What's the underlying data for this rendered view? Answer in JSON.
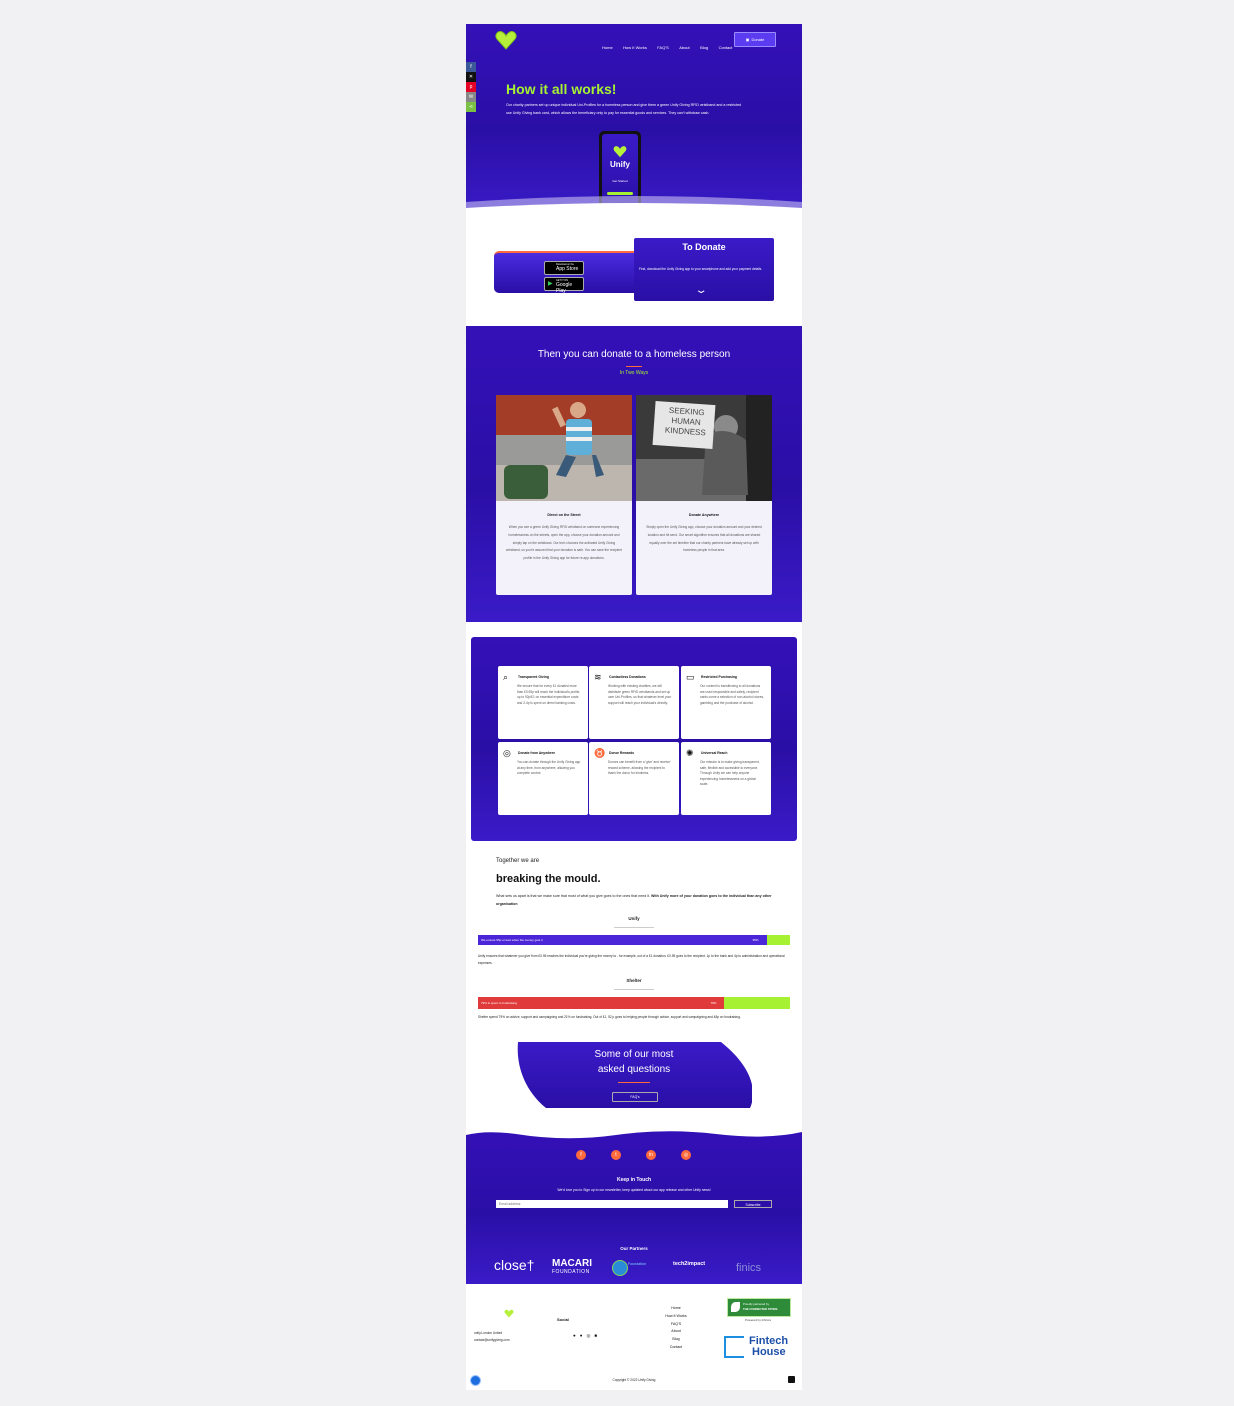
{
  "nav": {
    "items": [
      "Home",
      "How It Works",
      "FAQ'S",
      "About",
      "Blog",
      "Contact"
    ],
    "donate_label": "Donate"
  },
  "hero": {
    "title": "How it all works!",
    "body": "Our charity partners set up unique individual Uni-Profiles for a homeless person and give them a green Unify Giving RFID wristband and a restricted use Unify Giving bank card, which allows the beneficiary only to pay for essential goods and services. They can't withdraw cash.",
    "phone_brand": "Unify",
    "phone_cta": "Get Started"
  },
  "donate_box": {
    "title": "To Donate",
    "body": "First, download the Unify Giving app to your smartphone and add your payment details.",
    "app_store": "App Store",
    "app_store_small": "Download on the",
    "google_play": "Google Play",
    "google_play_small": "GET IT ON"
  },
  "ways": {
    "title": "Then you can donate to a homeless person",
    "subtitle": "In Two Ways",
    "cards": [
      {
        "title": "Direct on the Street",
        "body": "When you see a green Unify Giving RFID wristband on someone experiencing homelessness on the streets, open the app, choose your donation amount and simply tap on the wristband. Our tech chooses the activated Unify Giving wristband, so you're assured that your donation is safe. You can save the recipient profile in the Unify Giving app for future re-app donations."
      },
      {
        "title": "Donate Anywhere",
        "body": "Simply open the Unify Giving app, choose your donation amount and your desired location and hit send. Our smart algorithm ensures that all donations are shared equally over the set timeline that our charity partners have already set up with homeless people in that area."
      }
    ],
    "sign_text": "SEEKING HUMAN KINDNESS"
  },
  "features": [
    {
      "icon": "search-icon",
      "title": "Transparent Giving",
      "body": "We ensure that for every £1 donated more than £0.95p will reach the individual's profile, up to 92p/£1 on essential expenditure costs and 2-4p is spent on direct banking costs."
    },
    {
      "icon": "wifi-icon",
      "title": "Contactless Donations",
      "body": "Working with existing charities, we will distribute green RFID wristbands and set up user Uni-Profiles, so that whatever level your support will reach your individual's directly."
    },
    {
      "icon": "card-icon",
      "title": "Restricted Purchasing",
      "body": "Our content is transitioning to all donations are used responsible and safely, recipient cards come a selection of non-alcohol stores, gambling and the purchase of alcohol."
    },
    {
      "icon": "globe-icon",
      "title": "Donate from Anywhere",
      "body": "You can donate through the Unify Giving app at any time, from anywhere, allowing you complete control."
    },
    {
      "icon": "medal-icon",
      "title": "Donor Rewards",
      "body": "Donors can benefit from a 'give' and receive' reward scheme, allowing the recipient to thank the donor for kindness."
    },
    {
      "icon": "reach-icon",
      "title": "Universal Reach",
      "body": "Our mission is to make giving transparent, safe, flexible and accessible to everyone. Through Unify we can help anyone experiencing homelessness on a global scale."
    }
  ],
  "mould": {
    "pre": "Together we are",
    "title": "breaking the mould.",
    "body_plain": "What sets us apart is that we make sure that most of what you give goes to the ones that need it. ",
    "body_bold": "With Unify more of your donation goes to the individual than any other organisation",
    "unify": {
      "label": "Unify",
      "bar_text": "We ensure 95p or less when the money gets it",
      "pct_label": "95%",
      "pct": 92.5,
      "note": "Unify ensures that whatever you give from £0.95 reaches the individual you're giving the money to - for example, out of a £1 donation, £0.95 goes to the recipient. 1p to the bank and 4p to administration and operational expenses."
    },
    "shelter": {
      "label": "Shelter",
      "bar_text": "79% is spent to fundraising",
      "pct_label": "79%",
      "pct": 79,
      "note": "Shelter spend 79% on advice, support and campaigning and 21% on fundraising. Out of £1, 52 p goes to helping people through advice, support and campaigning and 48p on fundraising."
    }
  },
  "faq": {
    "title_line1": "Some of our most",
    "title_line2": "asked questions",
    "button": "FAQ's"
  },
  "footer_top": {
    "keep_title": "Keep in Touch",
    "keep_body": "We'd love you to Sign up to our newsletter, keep updated about our app release and other Unify news!",
    "email_placeholder": "Email address",
    "subscribe": "Subscribe",
    "partners_title": "Our Partners",
    "partners": [
      "close†",
      "MACARI",
      "FOUNDATION",
      "Foundation",
      "tech2impact",
      "finics"
    ]
  },
  "footer": {
    "address_line1": "unify.London United",
    "address_line2": "contact@unifygiving.com",
    "social_title": "Social",
    "links": [
      "Home",
      "How It Works",
      "FAQ'S",
      "About",
      "Blog",
      "Contact"
    ],
    "badge_line1": "Proudly partnered by",
    "badge_line2": "THE CONNECTED STORE",
    "powered": "Powered by Infinics",
    "fintech_line1": "Fintech",
    "fintech_line2": "House",
    "copyright": "Copyright © 2022 Unify Giving"
  },
  "colors": {
    "brand": "#2e10b0",
    "accent_green": "#a6f232",
    "accent_red": "#e03a3a",
    "accent_orange": "#ff6b3d"
  }
}
